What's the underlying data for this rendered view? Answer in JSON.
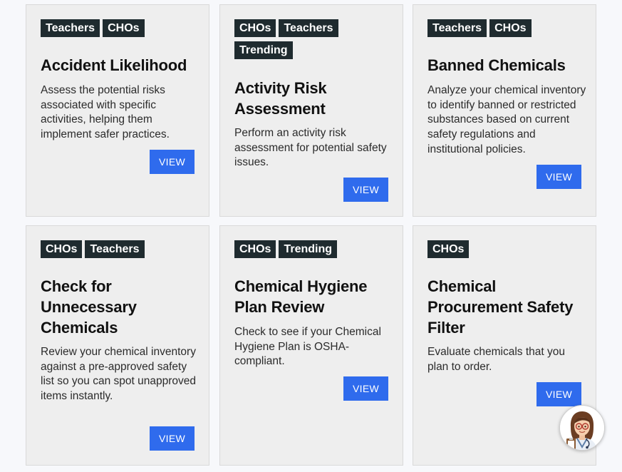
{
  "cards": [
    {
      "tags": [
        "Teachers",
        "CHOs"
      ],
      "title": "Accident Likelihood",
      "description": "Assess the potential risks associated with specific activities, helping them implement safer practices.",
      "button_label": "VIEW"
    },
    {
      "tags": [
        "CHOs",
        "Teachers",
        "Trending"
      ],
      "title": "Activity Risk Assessment",
      "description": "Perform an activity risk assessment for potential safety issues.",
      "button_label": "VIEW"
    },
    {
      "tags": [
        "Teachers",
        "CHOs"
      ],
      "title": "Banned Chemicals",
      "description": "Analyze your chemical inventory to identify banned or restricted substances based on current safety regulations and institutional policies.",
      "button_label": "VIEW"
    },
    {
      "tags": [
        "CHOs",
        "Teachers"
      ],
      "title": "Check for Unnecessary Chemicals",
      "description": "Review your chemical inventory against a pre-approved safety list so you can spot unapproved items instantly.",
      "button_label": "VIEW"
    },
    {
      "tags": [
        "CHOs",
        "Trending"
      ],
      "title": "Chemical Hygiene Plan Review",
      "description": "Check to see if your Chemical Hygiene Plan is OSHA-compliant.",
      "button_label": "VIEW"
    },
    {
      "tags": [
        "CHOs"
      ],
      "title": "Chemical Procurement Safety Filter",
      "description": "Evaluate chemicals that you plan to order.",
      "button_label": "VIEW"
    }
  ],
  "colors": {
    "tag_bg": "#1f2b2f",
    "button_bg": "#2f6bed",
    "card_bg": "#eeeeee"
  },
  "assistant": {
    "icon": "assistant-avatar-icon"
  }
}
